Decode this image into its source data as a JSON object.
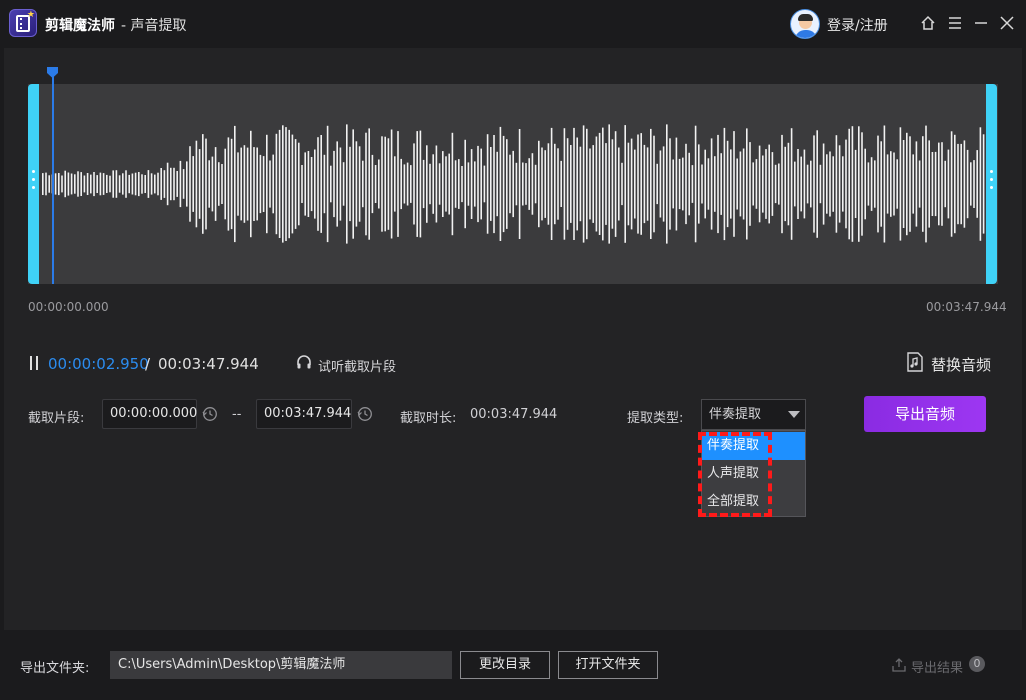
{
  "titlebar": {
    "app_name": "剪辑魔法师",
    "subtitle": "- 声音提取",
    "login_label": "登录/注册",
    "icons": [
      "user-avatar",
      "home-icon",
      "menu-icon",
      "minimize-icon",
      "close-icon"
    ]
  },
  "waveform": {
    "start_label": "00:00:00.000",
    "end_label": "00:03:47.944",
    "playhead_fraction": 0.013
  },
  "playback": {
    "current_time": "00:00:02.950",
    "separator": "/",
    "total_time": "00:03:47.944",
    "preview_label": "试听截取片段",
    "replace_label": "替换音频"
  },
  "clip": {
    "segment_label": "截取片段:",
    "start_value": "00:00:00.000",
    "dash": "--",
    "end_value": "00:03:47.944",
    "duration_label": "截取时长:",
    "duration_value": "00:03:47.944"
  },
  "extract": {
    "type_label": "提取类型:",
    "selected": "伴奏提取",
    "options": [
      "伴奏提取",
      "人声提取",
      "全部提取"
    ],
    "export_label": "导出音频"
  },
  "footer": {
    "folder_label": "导出文件夹:",
    "path": "C:\\Users\\Admin\\Desktop\\剪辑魔法师",
    "change_dir_label": "更改目录",
    "open_folder_label": "打开文件夹",
    "result_label": "导出结果",
    "result_count": "0"
  },
  "colors": {
    "accent_blue": "#2b8cf0",
    "handle_cyan": "#3fd2f7",
    "export_purple": "#9d37f2",
    "highlight_red": "#ff1a1a"
  }
}
